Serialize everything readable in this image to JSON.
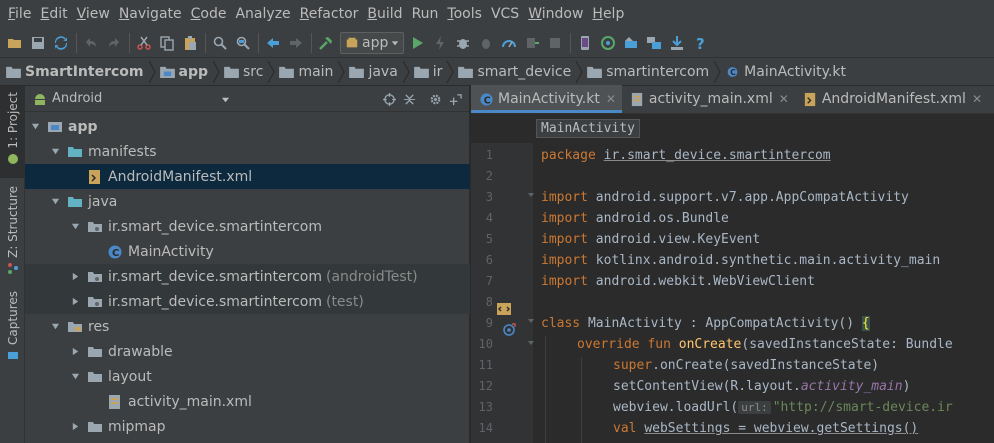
{
  "menu": [
    {
      "label": "File",
      "u": "F",
      "rest": "ile"
    },
    {
      "label": "Edit",
      "u": "E",
      "rest": "dit"
    },
    {
      "label": "View",
      "u": "V",
      "rest": "iew"
    },
    {
      "label": "Navigate",
      "u": "N",
      "rest": "avigate"
    },
    {
      "label": "Code",
      "u": "C",
      "rest": "ode"
    },
    {
      "label": "Analyze",
      "u": "",
      "rest": "Analyze"
    },
    {
      "label": "Refactor",
      "u": "R",
      "rest": "efactor"
    },
    {
      "label": "Build",
      "u": "B",
      "rest": "uild"
    },
    {
      "label": "Run",
      "u": "",
      "rest": "Run"
    },
    {
      "label": "Tools",
      "u": "T",
      "rest": "ools"
    },
    {
      "label": "VCS",
      "u": "",
      "rest": "VCS"
    },
    {
      "label": "Window",
      "u": "W",
      "rest": "indow"
    },
    {
      "label": "Help",
      "u": "H",
      "rest": "elp"
    }
  ],
  "toolbar": {
    "run_config": "app"
  },
  "breadcrumbs": [
    "SmartIntercom",
    "app",
    "src",
    "main",
    "java",
    "ir",
    "smart_device",
    "smartintercom",
    "MainActivity.kt"
  ],
  "left_tabs": {
    "project": "1: Project",
    "structure": "Z: Structure",
    "captures": "Captures"
  },
  "project": {
    "view_mode": "Android",
    "tree": [
      {
        "label": "app",
        "bold": true
      },
      {
        "label": "manifests"
      },
      {
        "label": "AndroidManifest.xml"
      },
      {
        "label": "java"
      },
      {
        "label": "ir.smart_device.smartintercom"
      },
      {
        "label": "MainActivity"
      },
      {
        "label": "ir.smart_device.smartintercom",
        "suffix": "(androidTest)"
      },
      {
        "label": "ir.smart_device.smartintercom",
        "suffix": "(test)"
      },
      {
        "label": "res"
      },
      {
        "label": "drawable"
      },
      {
        "label": "layout"
      },
      {
        "label": "activity_main.xml"
      },
      {
        "label": "mipmap"
      }
    ]
  },
  "editor": {
    "tabs": [
      "MainActivity.kt",
      "activity_main.xml",
      "AndroidManifest.xml"
    ],
    "breadcrumb": "MainActivity",
    "line_numbers": [
      "1",
      "2",
      "3",
      "4",
      "5",
      "6",
      "7",
      "8",
      "9",
      "10",
      "11",
      "12",
      "13",
      "14"
    ],
    "lines": {
      "l1_kw": "package ",
      "l1_rest": "ir.smart_device.smartintercom",
      "l3_kw": "import ",
      "l3_rest": "android.support.v7.app.AppCompatActivity",
      "l4_kw": "import ",
      "l4_rest": "android.os.Bundle",
      "l5_kw": "import ",
      "l5_rest": "android.view.KeyEvent",
      "l6_kw": "import ",
      "l6_rest": "kotlinx.android.synthetic.main.activity_main",
      "l7_kw": "import ",
      "l7_rest": "android.webkit.WebViewClient",
      "l9_kw": "class ",
      "l9_rest": "MainActivity : AppCompatActivity() ",
      "l9_brace": "{",
      "l10_kw": "override fun ",
      "l10_fn": "onCreate",
      "l10_rest": "(savedInstanceState: Bundle",
      "l11_kw": "super",
      "l11_rest": ".onCreate(savedInstanceState)",
      "l12_a": "setContentView(R.layout.",
      "l12_it": "activity_main",
      "l12_b": ")",
      "l13_a": "webview.loadUrl(",
      "l13_hint": "url:",
      "l13_str": "\"http://smart-device.ir",
      "l14_kw": "val ",
      "l14_rest": "webSettings = webview.getSettings()"
    }
  },
  "colors": {
    "bg": "#2b2b2b",
    "panel": "#3c3f41",
    "selection": "#0d293e",
    "keyword": "#cc7832",
    "function": "#ffc66d",
    "string": "#6a8759",
    "accent": "#4a88c7"
  }
}
